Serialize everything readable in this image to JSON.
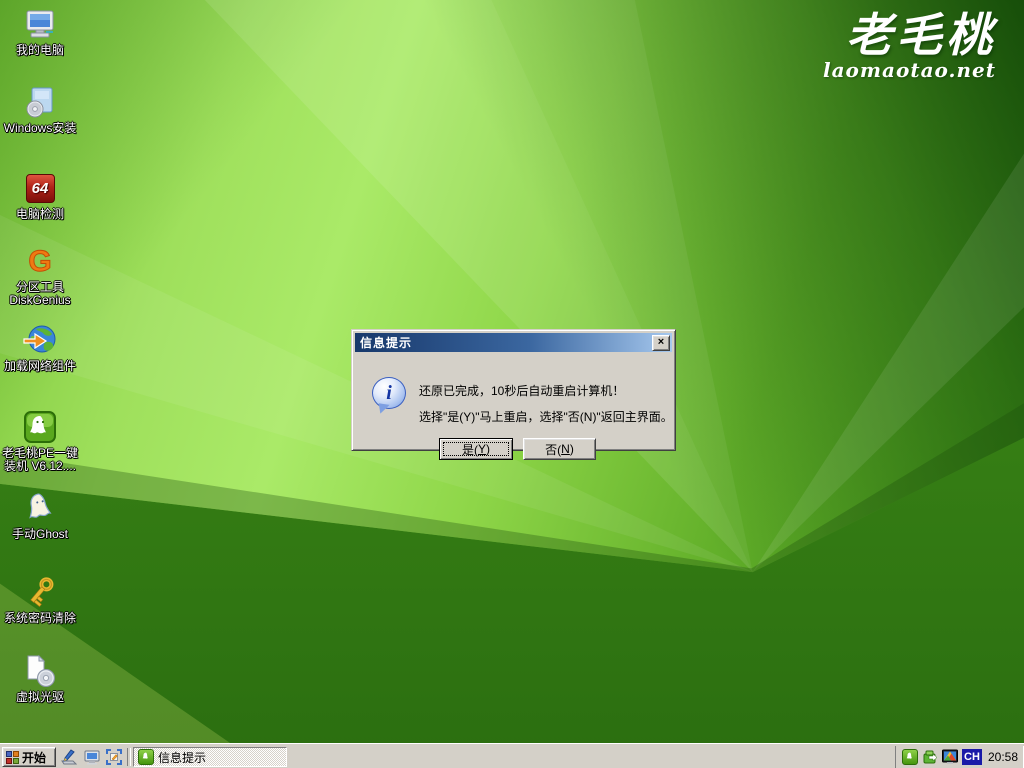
{
  "logo": {
    "title": "老毛桃",
    "subtitle": "laomaotao.net"
  },
  "desktop_icons": {
    "my_computer": "我的电脑",
    "windows_install": "Windows安装",
    "pc_test_badge": "64",
    "pc_test": "电脑检测",
    "diskgenius_line1": "分区工具",
    "diskgenius_line2": "DiskGenius",
    "network": "加载网络组件",
    "pe_line1": "老毛桃PE一键",
    "pe_line2": "装机 V6.12....",
    "manual_ghost": "手动Ghost",
    "password_clear": "系统密码清除",
    "virtual_cd": "虚拟光驱"
  },
  "dialog": {
    "title": "信息提示",
    "close": "×",
    "line1": "还原已完成，10秒后自动重启计算机！",
    "line2": "选择\"是(Y)\"马上重启，选择\"否(N)\"返回主界面。",
    "yes_pre": "是(",
    "yes_key": "Y",
    "yes_suf": ")",
    "no_pre": "否(",
    "no_key": "N",
    "no_suf": ")"
  },
  "taskbar": {
    "start": "开始",
    "task": "信息提示",
    "tray": {
      "language": "CH",
      "time": "20:58"
    }
  }
}
